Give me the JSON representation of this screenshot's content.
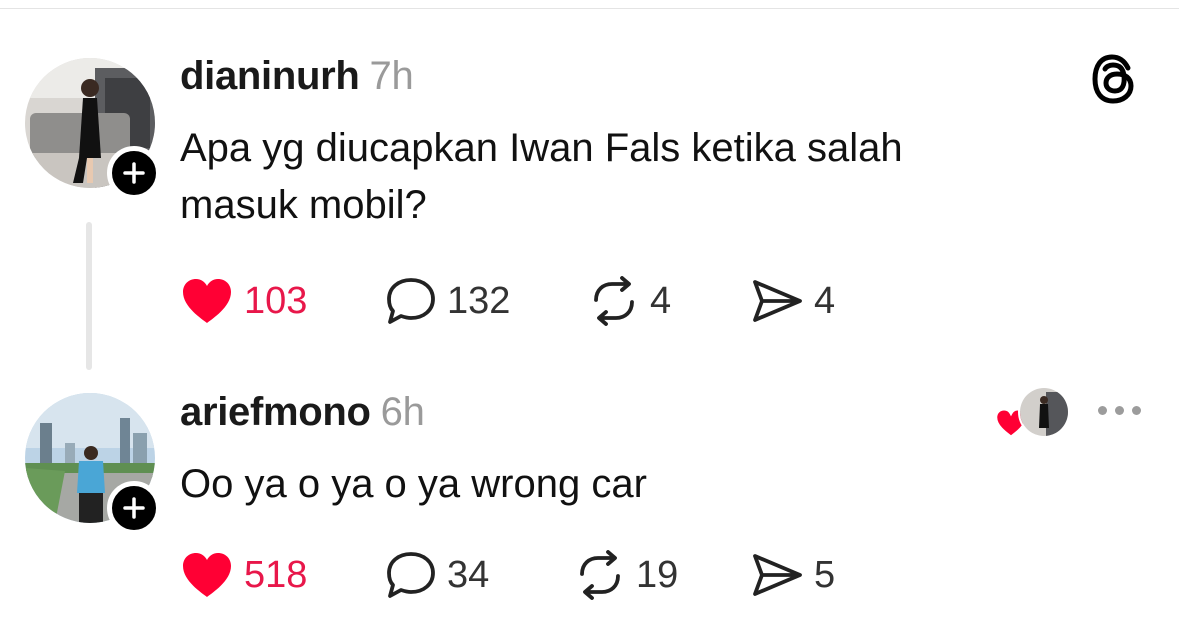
{
  "thread": {
    "post": {
      "username": "dianinurh",
      "time": "7h",
      "text": "Apa yg diucapkan Iwan Fals ketika salah masuk mobil?",
      "likes": "103",
      "replies": "132",
      "reposts": "4",
      "shares": "4",
      "liked": true
    },
    "reply": {
      "username": "ariefmono",
      "time": "6h",
      "text": "Oo ya o ya o ya wrong car",
      "likes": "518",
      "replies": "34",
      "reposts": "19",
      "shares": "5",
      "liked": true
    }
  },
  "icons": {
    "app_logo": "threads-logo-icon",
    "like": "heart-icon",
    "reply": "comment-bubble-icon",
    "repost": "repost-icon",
    "share": "send-icon",
    "follow": "plus-icon",
    "more": "more-options-icon"
  },
  "colors": {
    "like_active": "#ff0034",
    "count_liked": "#e8174a",
    "muted": "#9a9a9a",
    "badge": "#000000"
  }
}
